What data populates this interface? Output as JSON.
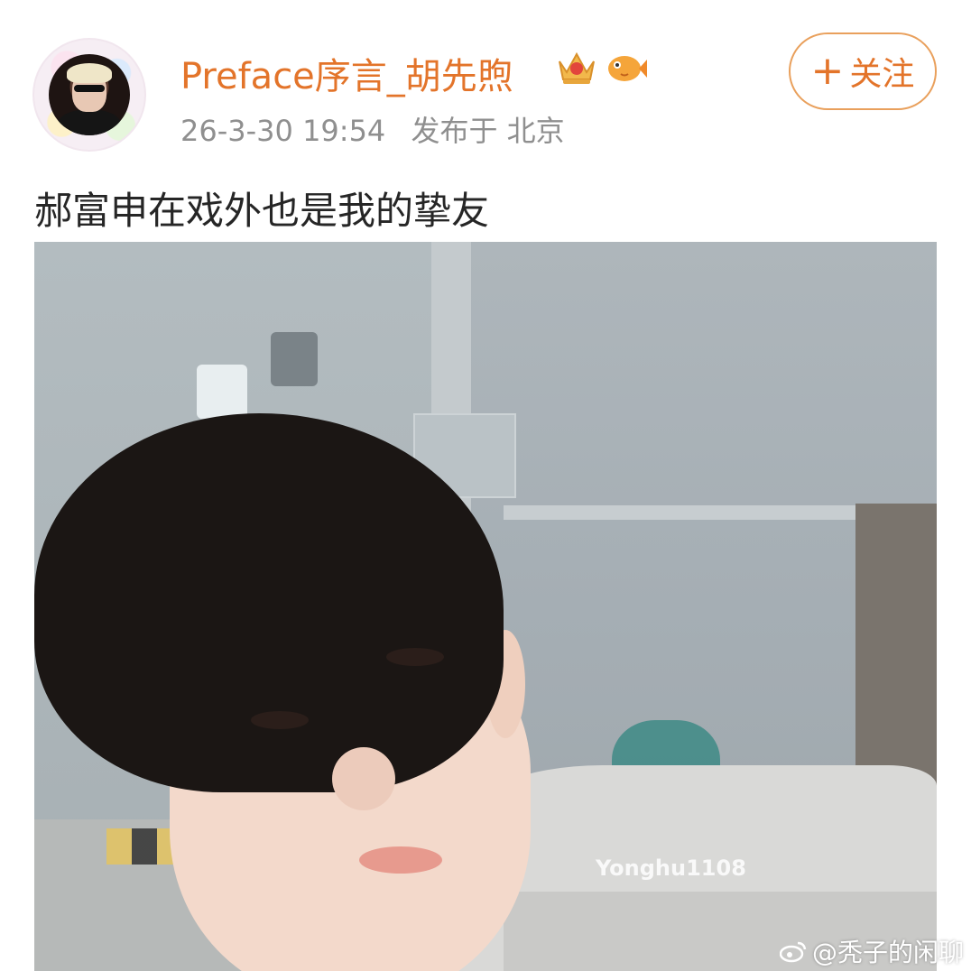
{
  "post": {
    "author": {
      "name": "Preface序言_胡先煦",
      "badges": [
        "crown-badge",
        "fish-badge"
      ]
    },
    "timestamp": "26-3-30 19:54",
    "location": "发布于 北京",
    "follow_label": "关注",
    "follow_icon": "plus-icon",
    "text": "郝富申在戏外也是我的挚友",
    "photo": {
      "watermark": "Yonghu1108"
    }
  },
  "source_watermark": "@秃子的闲聊",
  "colors": {
    "accent": "#e3742a",
    "meta": "#8f8f8f",
    "text": "#262626"
  }
}
